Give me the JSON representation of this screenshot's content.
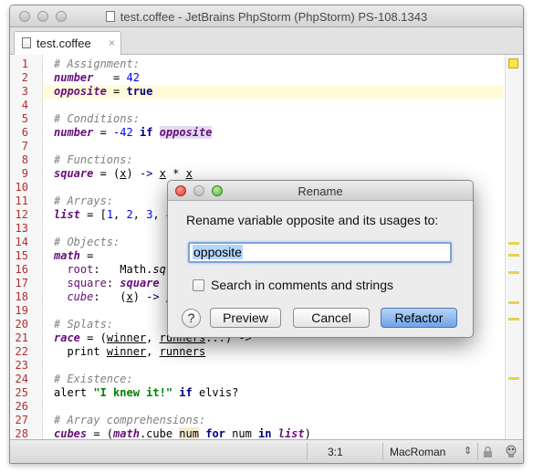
{
  "window": {
    "title": "test.coffee - JetBrains PhpStorm (PhpStorm) PS-108.1343"
  },
  "tabs": [
    {
      "label": "test.coffee",
      "close": "×"
    }
  ],
  "editor": {
    "line_numbers": [
      "1",
      "2",
      "3",
      "4",
      "5",
      "6",
      "7",
      "8",
      "9",
      "10",
      "11",
      "12",
      "13",
      "14",
      "15",
      "16",
      "17",
      "18",
      "19",
      "20",
      "21",
      "22",
      "23",
      "24",
      "25",
      "26",
      "27",
      "28"
    ],
    "current_line": 3
  },
  "status": {
    "position": "3:1",
    "encoding": "MacRoman",
    "encoding_arrow": "⇕"
  },
  "dialog": {
    "title": "Rename",
    "prompt": "Rename variable opposite and its usages to:",
    "input_value": "opposite",
    "checkbox_label": "Search in comments and strings",
    "help_label": "?",
    "buttons": {
      "preview": "Preview",
      "cancel": "Cancel",
      "refactor": "Refactor"
    }
  },
  "colors": {
    "line_number": "#b03030",
    "comment": "#808080",
    "variable": "#660e7a",
    "keyword": "#000080",
    "number": "#0000ff",
    "string": "#008000",
    "current_line_bg": "#fffbd9",
    "primary_button": "#6ea3e8"
  }
}
